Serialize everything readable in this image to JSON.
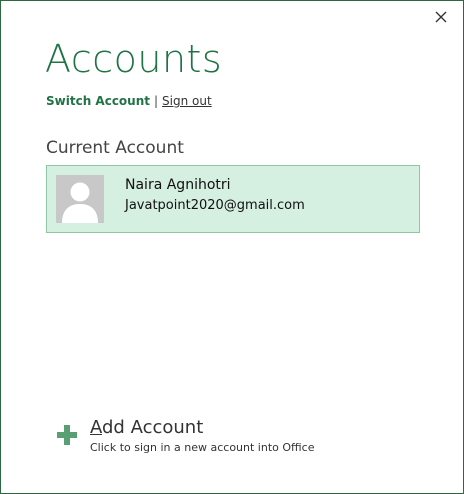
{
  "dialog": {
    "title": "Accounts",
    "close_icon": "close-icon"
  },
  "links": {
    "switch_account": "Switch Account",
    "separator": "|",
    "sign_out": "Sign out"
  },
  "current_account": {
    "heading": "Current Account",
    "name": "Naira Agnihotri",
    "email": "Javatpoint2020@gmail.com",
    "avatar_icon": "avatar-placeholder-icon"
  },
  "add_account": {
    "icon": "plus-icon",
    "mnemonic": "A",
    "label_rest": "dd Account",
    "description": "Click to sign in a new account into Office"
  },
  "colors": {
    "accent": "#217346",
    "card_bg": "#d5efe0",
    "card_border": "#8fc6a6"
  }
}
